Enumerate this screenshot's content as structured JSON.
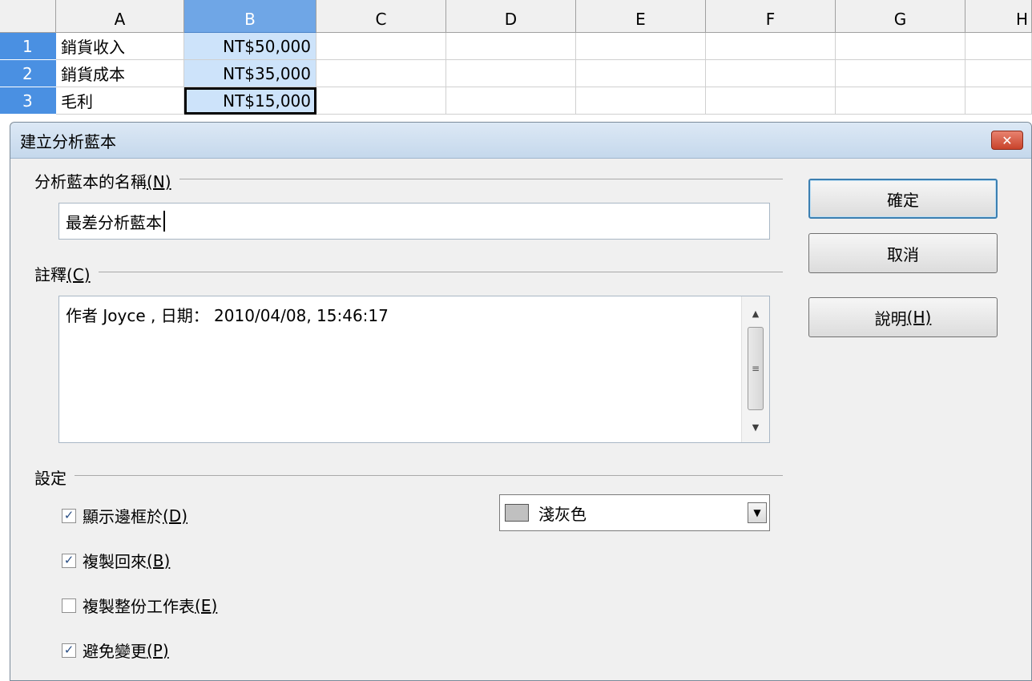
{
  "sheet": {
    "columns": [
      "A",
      "B",
      "C",
      "D",
      "E",
      "F",
      "G",
      "H"
    ],
    "rows": [
      {
        "num": "1",
        "label": "銷貨收入",
        "value": "NT$50,000"
      },
      {
        "num": "2",
        "label": "銷貨成本",
        "value": "NT$35,000"
      },
      {
        "num": "3",
        "label": "毛利",
        "value": "NT$15,000"
      }
    ]
  },
  "dialog": {
    "title": "建立分析藍本",
    "close_label": "✕",
    "name_section": "分析藍本的名稱",
    "name_accel": "(N)",
    "name_value": "最差分析藍本",
    "comment_section": "註釋",
    "comment_accel": "(C)",
    "comment_value": "作者 Joyce , 日期： 2010/04/08, 15:46:17",
    "settings_section": "設定",
    "buttons": {
      "ok": "確定",
      "cancel": "取消",
      "help": "說明",
      "help_accel": "(H)"
    },
    "options": [
      {
        "label": "顯示邊框於",
        "accel": "(D)",
        "checked": true
      },
      {
        "label": "複製回來",
        "accel": "(B)",
        "checked": true
      },
      {
        "label": "複製整份工作表",
        "accel": "(E)",
        "checked": false
      },
      {
        "label": "避免變更",
        "accel": "(P)",
        "checked": true
      }
    ],
    "border_color": {
      "label": "淺灰色",
      "swatch": "#c0c0c0"
    }
  },
  "colors": {
    "selection_header": "#4a90e2",
    "selected_cell": "#cde3fa",
    "dialog_bg": "#f0f0f0"
  }
}
